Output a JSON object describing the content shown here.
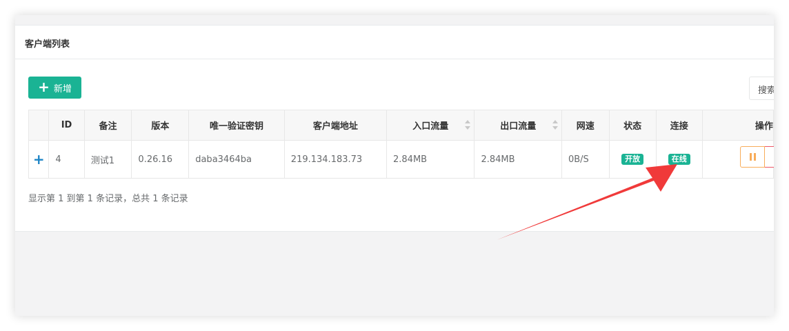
{
  "panel": {
    "title": "客户端列表"
  },
  "toolbar": {
    "add_label": "新增",
    "search_placeholder": "搜索"
  },
  "table": {
    "headers": [
      "",
      "ID",
      "备注",
      "版本",
      "唯一验证密钥",
      "客户端地址",
      "入口流量",
      "出口流量",
      "网速",
      "状态",
      "连接",
      "操作"
    ],
    "rows": [
      {
        "id": "4",
        "remark": "测试1",
        "version": "0.26.16",
        "vkey": "daba3464ba",
        "address": "219.134.183.73",
        "inflow": "2.84MB",
        "outflow": "2.84MB",
        "speed": "0B/S",
        "status": "开放",
        "connect": "在线"
      }
    ]
  },
  "footer": {
    "info": "显示第 1 到第 1 条记录，总共 1 条记录"
  },
  "colors": {
    "primary": "#1ab394",
    "link_blue": "#1c84c6",
    "warning": "#f8ac59",
    "danger": "#ed5565",
    "annotation_arrow": "#f03a3a"
  },
  "icons": {
    "add": "plus-icon",
    "expand": "plus-icon",
    "pause": "pause-icon"
  }
}
